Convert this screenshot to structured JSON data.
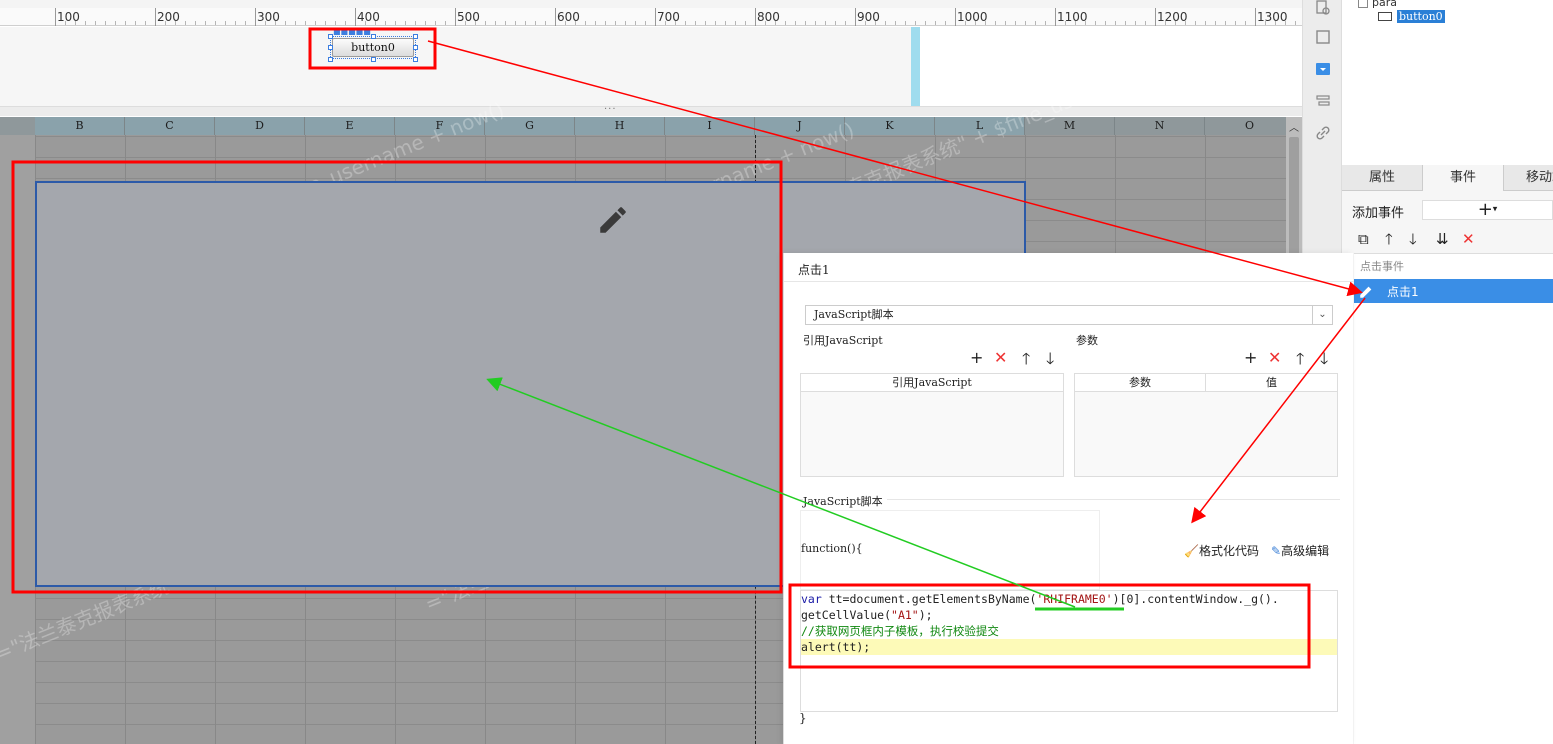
{
  "ruler": {
    "labels": [
      "100",
      "200",
      "300",
      "400",
      "500",
      "600",
      "700",
      "800",
      "900",
      "1000",
      "1100",
      "1200",
      "1300"
    ]
  },
  "canvas": {
    "button_label": "button0"
  },
  "sheet": {
    "columns": [
      "B",
      "C",
      "D",
      "E",
      "F",
      "G",
      "H",
      "I",
      "J",
      "K",
      "L",
      "M",
      "N",
      "O"
    ],
    "watermark": "=\"法兰泰克报表系统\" + $fine_username + now()"
  },
  "tree": {
    "root": "para",
    "selected": "button0"
  },
  "tabs": {
    "attributes": "属性",
    "events": "事件",
    "mobile": "移动端"
  },
  "events": {
    "add_label": "添加事件",
    "add_symbol": "+",
    "category": "点击事件",
    "item": "点击1"
  },
  "dialog": {
    "title": "点击1",
    "type_value": "JavaScript脚本",
    "ref_js_label": "引用JavaScript",
    "ref_js_header": "引用JavaScript",
    "params_label": "参数",
    "params_col1": "参数",
    "params_col2": "值",
    "script_label": "JavaScript脚本",
    "function_label": "function(){",
    "format_code": "格式化代码",
    "advanced_edit": "高级编辑",
    "closing_brace": "}",
    "code": {
      "line1_kw": "var",
      "line1_a": " tt=document.getElementsByName(",
      "line1_str": "'RHIFRAME0'",
      "line1_b": ")[0].contentWindow._g().",
      "line2_a": "getCellValue(",
      "line2_str": "\"A1\"",
      "line2_b": ");",
      "line3": "//获取网页框内子模板，执行校验提交",
      "line4": "alert(tt);"
    }
  },
  "colors": {
    "annotation_red": "#ff0000",
    "annotation_green": "#22cc22",
    "selection_blue": "#3a8ee6"
  }
}
